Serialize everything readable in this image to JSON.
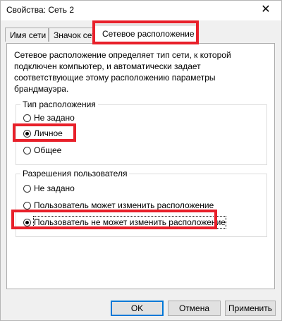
{
  "window": {
    "title": "Свойства: Сеть  2",
    "close_glyph": "✕"
  },
  "tabs": [
    {
      "label": "Имя сети"
    },
    {
      "label": "Значок сети"
    },
    {
      "label": "Сетевое расположение"
    }
  ],
  "description": "Сетевое расположение определяет тип сети, к которой подключен компьютер, и автоматически задает соответствующие этому расположению параметры брандмауэра.",
  "location_type": {
    "legend": "Тип расположения",
    "options": [
      {
        "label": "Не задано",
        "checked": false
      },
      {
        "label": "Личное",
        "checked": true
      },
      {
        "label": "Общее",
        "checked": false
      }
    ]
  },
  "user_permissions": {
    "legend": "Разрешения пользователя",
    "options": [
      {
        "label": "Не задано",
        "checked": false
      },
      {
        "label": "Пользователь может изменить расположение",
        "checked": false
      },
      {
        "label": "Пользователь не может изменить расположение",
        "checked": true
      }
    ]
  },
  "buttons": {
    "ok": "OK",
    "cancel": "Отмена",
    "apply": "Применить"
  },
  "colors": {
    "highlight": "#e8202a",
    "default_button_border": "#0078d7"
  }
}
